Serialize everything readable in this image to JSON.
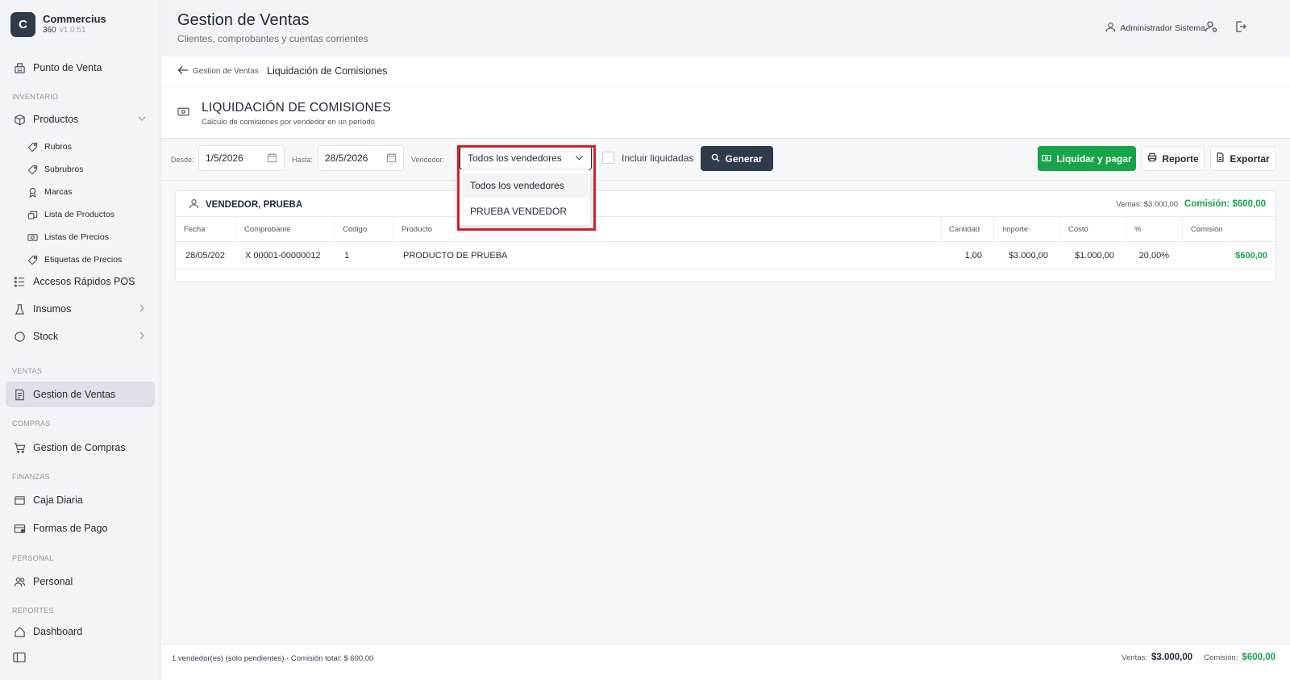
{
  "app": {
    "logo_letter": "C",
    "name": "Commercius",
    "edition": "360",
    "version": "v1.0.51"
  },
  "sidebar": {
    "punto_venta": "Punto de Venta",
    "sec_inventario": "INVENTARIO",
    "productos": "Productos",
    "sub": [
      "Rubros",
      "Subrubros",
      "Marcas",
      "Lista de Productos",
      "Listas de Precios",
      "Etiquetas de Precios"
    ],
    "accesos": "Accesos Rápidos POS",
    "insumos": "Insumos",
    "stock": "Stock",
    "sec_ventas": "VENTAS",
    "gestion_ventas": "Gestion de Ventas",
    "sec_compras": "COMPRAS",
    "gestion_compras": "Gestion de Compras",
    "sec_finanzas": "FINANZAS",
    "caja": "Caja Diaria",
    "formas_pago": "Formas de Pago",
    "sec_personal": "PERSONAL",
    "personal": "Personal",
    "sec_reportes": "REPORTES",
    "dashboard": "Dashboard"
  },
  "header": {
    "title": "Gestion de Ventas",
    "subtitle": "Clientes, comprobantes y cuentas corrientes",
    "user": "Administrador Sistema"
  },
  "breadcrumb": {
    "back": "Gestion de Ventas",
    "current": "Liquidación de Comisiones"
  },
  "page": {
    "title": "LIQUIDACIÓN DE COMISIONES",
    "subtitle": "Cálculo de comisiones por vendedor en un período"
  },
  "filters": {
    "desde_label": "Desde:",
    "desde_value": "1/5/2026",
    "hasta_label": "Hasta:",
    "hasta_value": "28/5/2026",
    "vendedor_label": "Vendedor:",
    "vendedor_value": "Todos los vendedores",
    "vendedor_options": [
      "Todos los vendedores",
      "PRUEBA VENDEDOR"
    ],
    "incluir_label": "Incluir liquidadas",
    "generar": "Generar",
    "liquidar": "Liquidar y pagar",
    "reporte": "Reporte",
    "exportar": "Exportar"
  },
  "card": {
    "vendedor": "VENDEDOR, PRUEBA",
    "ventas": "Ventas: $3.000,00",
    "comision": "Comisión: $600,00",
    "columns": [
      "Fecha",
      "Comprobante",
      "Código",
      "Producto",
      "Cantidad",
      "Importe",
      "Costo",
      "%",
      "Comisión"
    ],
    "rows": [
      {
        "fecha": "28/05/202",
        "comprobante": "X 00001-00000012",
        "codigo": "1",
        "producto": "PRODUCTO DE PRUEBA",
        "cantidad": "1,00",
        "importe": "$3.000,00",
        "costo": "$1.000,00",
        "pct": "20,00%",
        "comision": "$600,00"
      }
    ]
  },
  "footer": {
    "summary": "1 vendedor(es) (solo pendientes) · Comisión total: $ 600,00",
    "ventas_label": "Ventas:",
    "ventas_value": "$3.000,00",
    "comision_label": "Comisión:",
    "comision_value": "$600,00"
  },
  "colors": {
    "accent_green": "#17a34a",
    "dark_button": "#2f3a4a",
    "highlight_red": "#d6202a"
  }
}
